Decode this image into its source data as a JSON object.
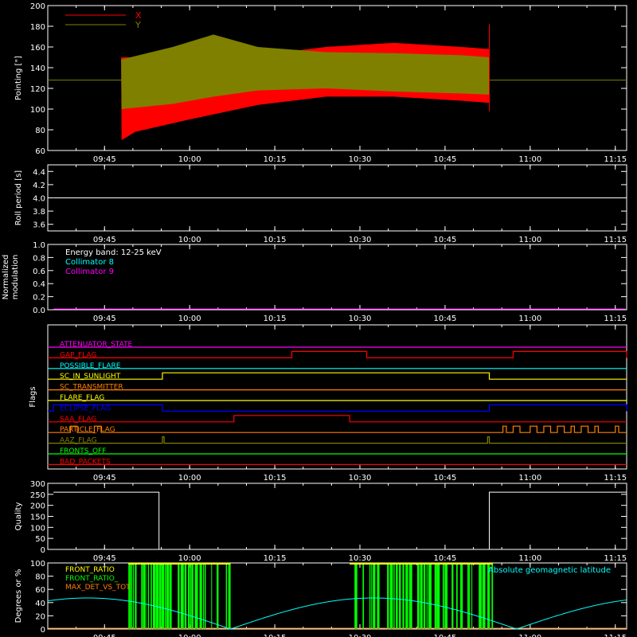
{
  "figure": {
    "background": "#000000",
    "axis_color": "#ffffff",
    "time_ticks": [
      "09:45",
      "10:00",
      "10:15",
      "10:30",
      "10:45",
      "11:00",
      "11:15"
    ]
  },
  "chart_data": [
    {
      "id": "pointing",
      "type": "line",
      "ylabel": "Pointing [\"]",
      "ylim": [
        60,
        200
      ],
      "yticks": [
        60,
        80,
        100,
        120,
        140,
        160,
        180,
        200
      ],
      "xlim": [
        "09:35",
        "11:17"
      ],
      "legend": [
        {
          "label": "X",
          "color": "#ff0000"
        },
        {
          "label": "Y",
          "color": "#808000"
        }
      ],
      "series": [
        {
          "name": "X",
          "color": "#ff0000",
          "kind": "oscillating-band",
          "upper": [
            [
              9.8,
              150
            ],
            [
              10.0,
              150
            ],
            [
              10.2,
              152
            ],
            [
              10.4,
              160
            ],
            [
              10.6,
              164
            ],
            [
              10.8,
              160
            ],
            [
              10.88,
              158
            ]
          ],
          "lower": [
            [
              9.8,
              70
            ],
            [
              9.84,
              78
            ],
            [
              10.0,
              90
            ],
            [
              10.2,
              104
            ],
            [
              10.4,
              112
            ],
            [
              10.6,
              112
            ],
            [
              10.8,
              108
            ],
            [
              10.88,
              106
            ]
          ]
        },
        {
          "name": "Y",
          "color": "#808000",
          "kind": "oscillating-band",
          "upper": [
            [
              9.8,
              148
            ],
            [
              9.95,
              160
            ],
            [
              10.07,
              172
            ],
            [
              10.2,
              160
            ],
            [
              10.4,
              155
            ],
            [
              10.6,
              154
            ],
            [
              10.8,
              152
            ],
            [
              10.88,
              150
            ]
          ],
          "lower": [
            [
              9.8,
              100
            ],
            [
              9.95,
              105
            ],
            [
              10.07,
              112
            ],
            [
              10.2,
              118
            ],
            [
              10.4,
              120
            ],
            [
              10.6,
              117
            ],
            [
              10.8,
              115
            ],
            [
              10.88,
              114
            ]
          ]
        }
      ],
      "baseline": {
        "value": 128,
        "color": "#808000"
      }
    },
    {
      "id": "roll",
      "type": "line",
      "ylabel": "Roll period [s]",
      "ylim": [
        3.5,
        4.5
      ],
      "yticks": [
        3.6,
        3.8,
        4.0,
        4.2,
        4.4
      ],
      "series": [
        {
          "name": "",
          "color": "#ffffff",
          "values": [
            [
              9.6,
              4.0
            ],
            [
              11.28,
              4.0
            ]
          ]
        }
      ]
    },
    {
      "id": "modulation",
      "type": "line",
      "ylabel": [
        "Normalized",
        "modulation"
      ],
      "ylim": [
        0,
        1.0
      ],
      "yticks": [
        0.0,
        0.2,
        0.4,
        0.6,
        0.8,
        1.0
      ],
      "annotations": [
        {
          "text": "Energy band: 12-25 keV",
          "color": "#ffffff"
        },
        {
          "text": "Collimator 8",
          "color": "#00ffff"
        },
        {
          "text": "Collimator 9",
          "color": "#ff00ff"
        }
      ],
      "series": [
        {
          "name": "",
          "color": "#ff00ff",
          "values": [
            [
              9.6,
              0.0
            ],
            [
              11.28,
              0.0
            ]
          ]
        }
      ]
    },
    {
      "id": "flags",
      "type": "line",
      "ylabel": "Flags",
      "flags": [
        {
          "label": "ATTENUATOR_STATE",
          "color": "#ff00ff",
          "segments": []
        },
        {
          "label": "GAP_FLAG",
          "color": "#ff0000",
          "segments": [
            [
              10.3,
              10.52
            ],
            [
              10.95,
              11.3
            ]
          ]
        },
        {
          "label": "POSSIBLE_FLARE",
          "color": "#00ffff",
          "segments": []
        },
        {
          "label": "SC_IN_SUNLIGHT",
          "color": "#ffff00",
          "segments": [
            [
              9.92,
              10.88
            ]
          ]
        },
        {
          "label": "SC_TRANSMITTER",
          "color": "#ff8000",
          "segments": []
        },
        {
          "label": "FLARE_FLAG",
          "color": "#ffff00",
          "segments": []
        },
        {
          "label": "ECLIPSE_FLAG",
          "color": "#0000ff",
          "segments": [
            [
              9.6,
              9.92
            ],
            [
              10.88,
              11.3
            ]
          ]
        },
        {
          "label": "SAA_FLAG",
          "color": "#ff0000",
          "segments": [
            [
              10.13,
              10.47
            ]
          ]
        },
        {
          "label": "PARTICLE_FLAG",
          "color": "#ff8000",
          "segments": [
            [
              9.65,
              9.67
            ],
            [
              9.72,
              9.74
            ],
            [
              10.92,
              10.93
            ],
            [
              10.95,
              10.97
            ],
            [
              11.0,
              11.02
            ],
            [
              11.04,
              11.06
            ],
            [
              11.08,
              11.1
            ],
            [
              11.12,
              11.13
            ],
            [
              11.15,
              11.17
            ],
            [
              11.19,
              11.2
            ],
            [
              11.25,
              11.26
            ]
          ]
        },
        {
          "label": "AAZ_FLAG",
          "color": "#808000",
          "segments": [
            [
              9.92,
              9.925
            ],
            [
              10.875,
              10.88
            ]
          ]
        },
        {
          "label": "FRONTS_OFF",
          "color": "#00ff00",
          "segments": []
        },
        {
          "label": "BAD_PACKETS",
          "color": "#ff0000",
          "segments": []
        }
      ]
    },
    {
      "id": "quality",
      "type": "line",
      "ylabel": "Quality",
      "ylim": [
        0,
        300
      ],
      "yticks": [
        0,
        50,
        100,
        150,
        200,
        250,
        300
      ],
      "series": [
        {
          "name": "",
          "color": "#ffffff",
          "values": [
            [
              9.6,
              260
            ],
            [
              9.91,
              260
            ],
            [
              9.91,
              0
            ],
            [
              10.88,
              0
            ],
            [
              10.88,
              260
            ],
            [
              11.3,
              260
            ]
          ]
        }
      ]
    },
    {
      "id": "ratios",
      "type": "line",
      "ylabel": "Degrees or %",
      "ylim": [
        0,
        100
      ],
      "yticks": [
        0,
        20,
        40,
        60,
        80,
        100
      ],
      "legend": [
        {
          "label": "FRONT_RATIO",
          "color": "#ffff00"
        },
        {
          "label": "FRONT_RATIO_",
          "color": "#00ff00"
        },
        {
          "label": "MAX_DET_VS_TOT",
          "color": "#ff8000"
        }
      ],
      "annotations": [
        {
          "text": "Absolute geomagnetic latitude",
          "color": "#00ffff"
        }
      ],
      "green_bands": [
        [
          9.82,
          10.12
        ],
        [
          10.47,
          10.89
        ]
      ],
      "series": [
        {
          "name": "Absolute geomagnetic latitude",
          "color": "#00ffff",
          "kind": "abs-sine",
          "amplitude": 47,
          "period_h": 0.84,
          "zero_at": 10.12
        }
      ]
    }
  ]
}
